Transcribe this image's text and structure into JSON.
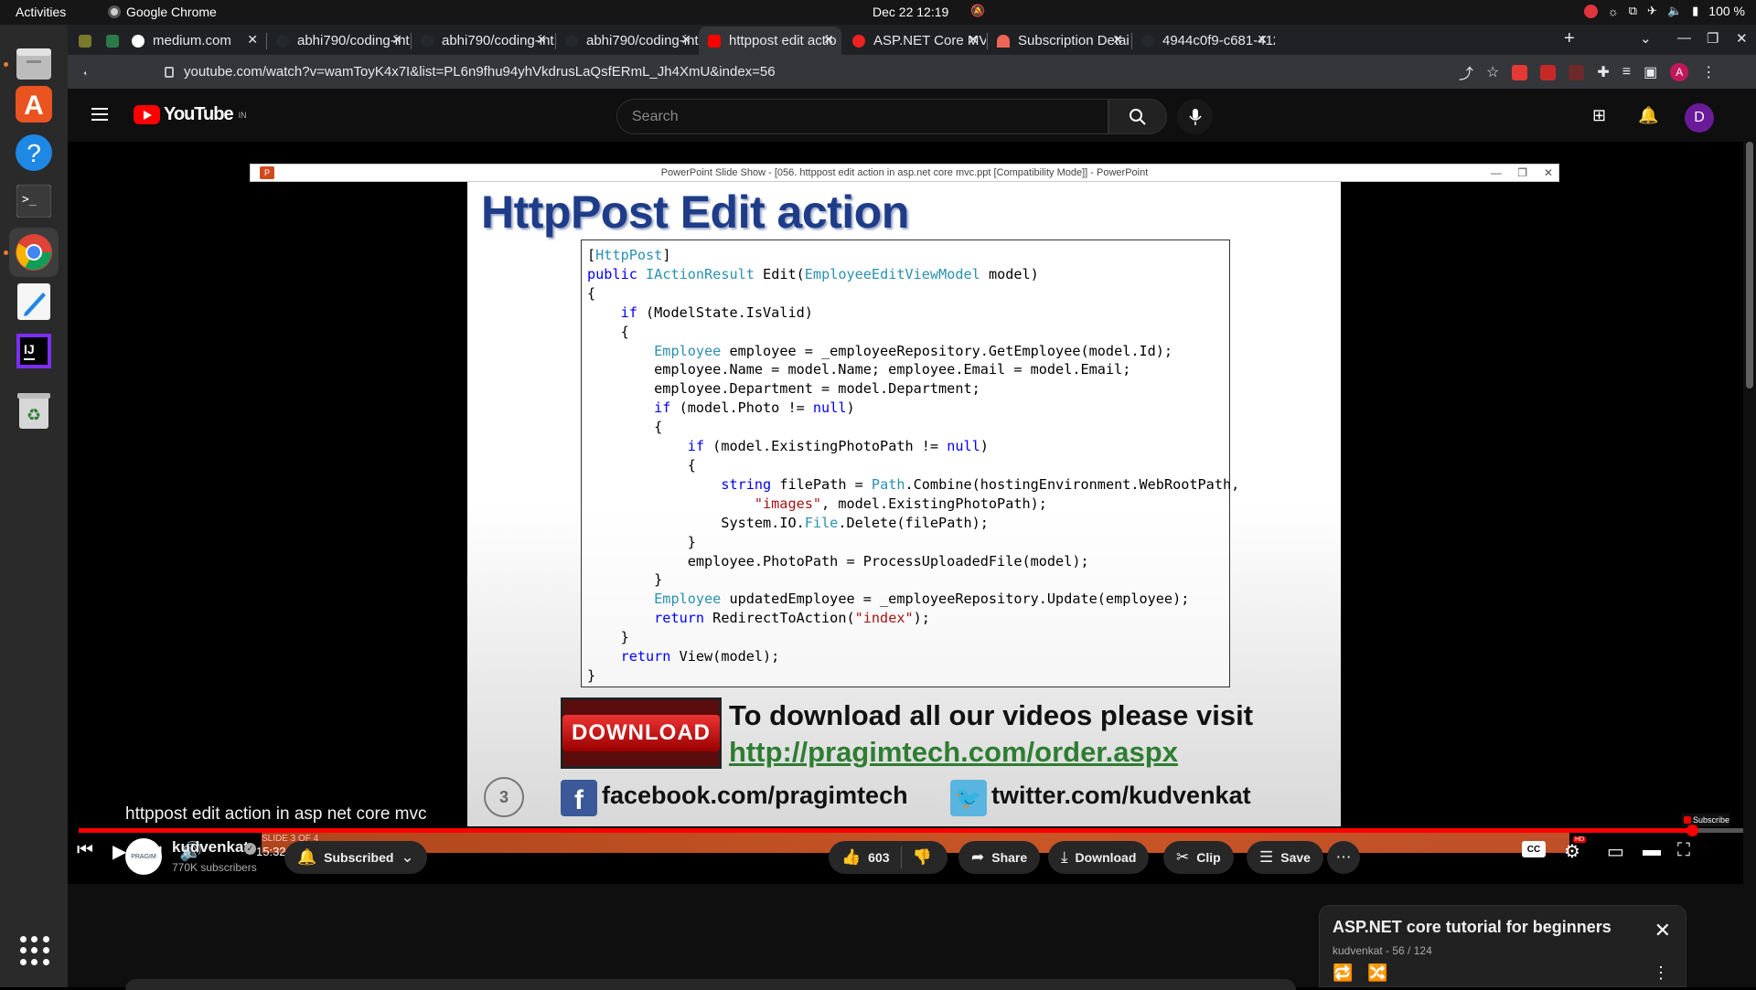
{
  "system_bar": {
    "activities": "Activities",
    "app_name": "Google Chrome",
    "clock": "Dec 22  12:19",
    "battery": "100 %"
  },
  "dock": {
    "items": [
      "files",
      "app-center",
      "help",
      "terminal",
      "chrome",
      "text-editor",
      "intellij",
      "trash"
    ],
    "show_apps_label": "Show Applications"
  },
  "tabs": [
    {
      "label": "",
      "icon": "pin-icon"
    },
    {
      "label": "",
      "icon": "link-icon"
    },
    {
      "label": "medium.com",
      "icon": "medium-icon"
    },
    {
      "label": "abhi790/coding-int",
      "icon": "github-icon"
    },
    {
      "label": "abhi790/coding-int",
      "icon": "github-icon"
    },
    {
      "label": "abhi790/coding-int",
      "icon": "github-icon"
    },
    {
      "label": "httppost edit actio",
      "icon": "youtube-icon",
      "active": true
    },
    {
      "label": "ASP.NET Core MVC",
      "icon": "opera-icon"
    },
    {
      "label": "Subscription Detai",
      "icon": "arc-icon"
    },
    {
      "label": "4944c0f9-c681-412",
      "icon": "github-icon"
    }
  ],
  "address_bar": {
    "url": "youtube.com/watch?v=wamToyK4x7I&list=PL6n9fhu94yhVkdrusLaQsfERmL_Jh4XmU&index=56",
    "extension_badge": "3"
  },
  "youtube": {
    "logo_text": "YouTube",
    "region": "IN",
    "search_placeholder": "Search",
    "avatar_letter": "D"
  },
  "ppt": {
    "window_title": "PowerPoint Slide Show - [056. httppost edit action in asp.net core mvc.ppt [Compatibility Mode]] - PowerPoint",
    "slide_title": "HttpPost Edit action",
    "download_button": "DOWNLOAD",
    "download_text": "To download all our videos please visit",
    "download_link": "http://pragimtech.com/order.aspx",
    "slide_number": "3",
    "facebook": "facebook.com/pragimtech",
    "twitter": "twitter.com/kudvenkat",
    "slide_indicator": "SLIDE 3 OF 4",
    "subscribe_watermark": "Subscribe"
  },
  "player": {
    "time": "15:32 / 16:01",
    "progress": 0.968,
    "cc_label": "CC",
    "hd_label": "HD"
  },
  "video": {
    "title": "httppost edit action in asp net core mvc",
    "channel": "kudvenkat",
    "subscribers": "770K subscribers",
    "subscribed_label": "Subscribed",
    "likes": "603",
    "share_label": "Share",
    "download_label": "Download",
    "clip_label": "Clip",
    "save_label": "Save",
    "channel_avatar_text": "PRAGIM"
  },
  "playlist": {
    "title": "ASP.NET core tutorial for beginners",
    "subtitle": "kudvenkat - 56 / 124"
  }
}
